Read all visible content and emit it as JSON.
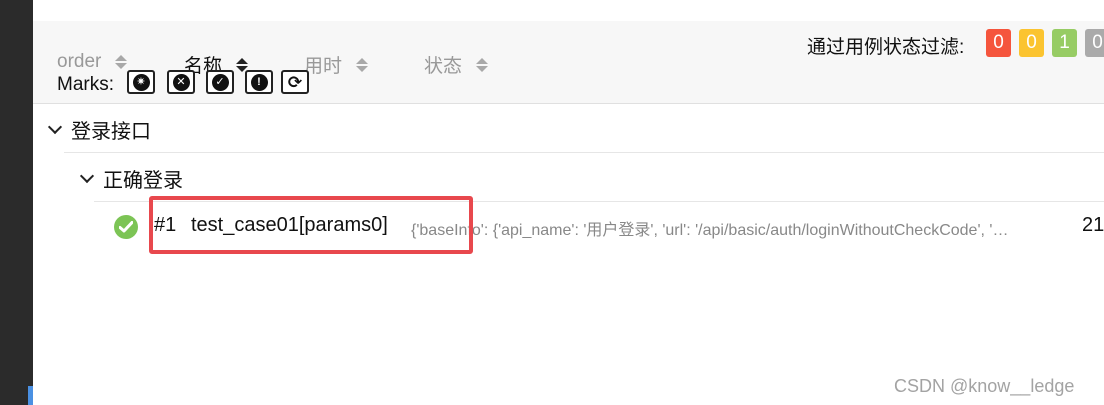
{
  "sort_columns": [
    {
      "label": "order",
      "active": false
    },
    {
      "label": "名称",
      "active": true
    },
    {
      "label": "用时",
      "active": false
    },
    {
      "label": "状态",
      "active": false
    }
  ],
  "filter": {
    "label": "通过用例状态过滤:",
    "badges": [
      {
        "value": "0",
        "color": "#f5553d"
      },
      {
        "value": "0",
        "color": "#fbc430"
      },
      {
        "value": "1",
        "color": "#97cc64"
      },
      {
        "value": "0",
        "color": "#aaaaaa"
      }
    ]
  },
  "marks": {
    "label": "Marks:",
    "buttons": [
      {
        "icon": "bomb-icon",
        "glyph": "✷"
      },
      {
        "icon": "times-circle-icon",
        "glyph": "✕"
      },
      {
        "icon": "check-circle-icon",
        "glyph": "✓"
      },
      {
        "icon": "exclamation-circle-icon",
        "glyph": "!"
      },
      {
        "icon": "refresh-icon",
        "glyph": "⟳"
      }
    ]
  },
  "suite": {
    "title": "登录接口"
  },
  "subgroup": {
    "title": "正确登录"
  },
  "test_case": {
    "status": "passed",
    "status_icon": "check-circle-icon",
    "number": "#1",
    "name": "test_case01[params0]",
    "params": "{'baseInfo': {'api_name': '用户登录', 'url': '/api/basic/auth/loginWithoutCheckCode', '…",
    "time": "21"
  },
  "watermark": "CSDN @know__ledge"
}
